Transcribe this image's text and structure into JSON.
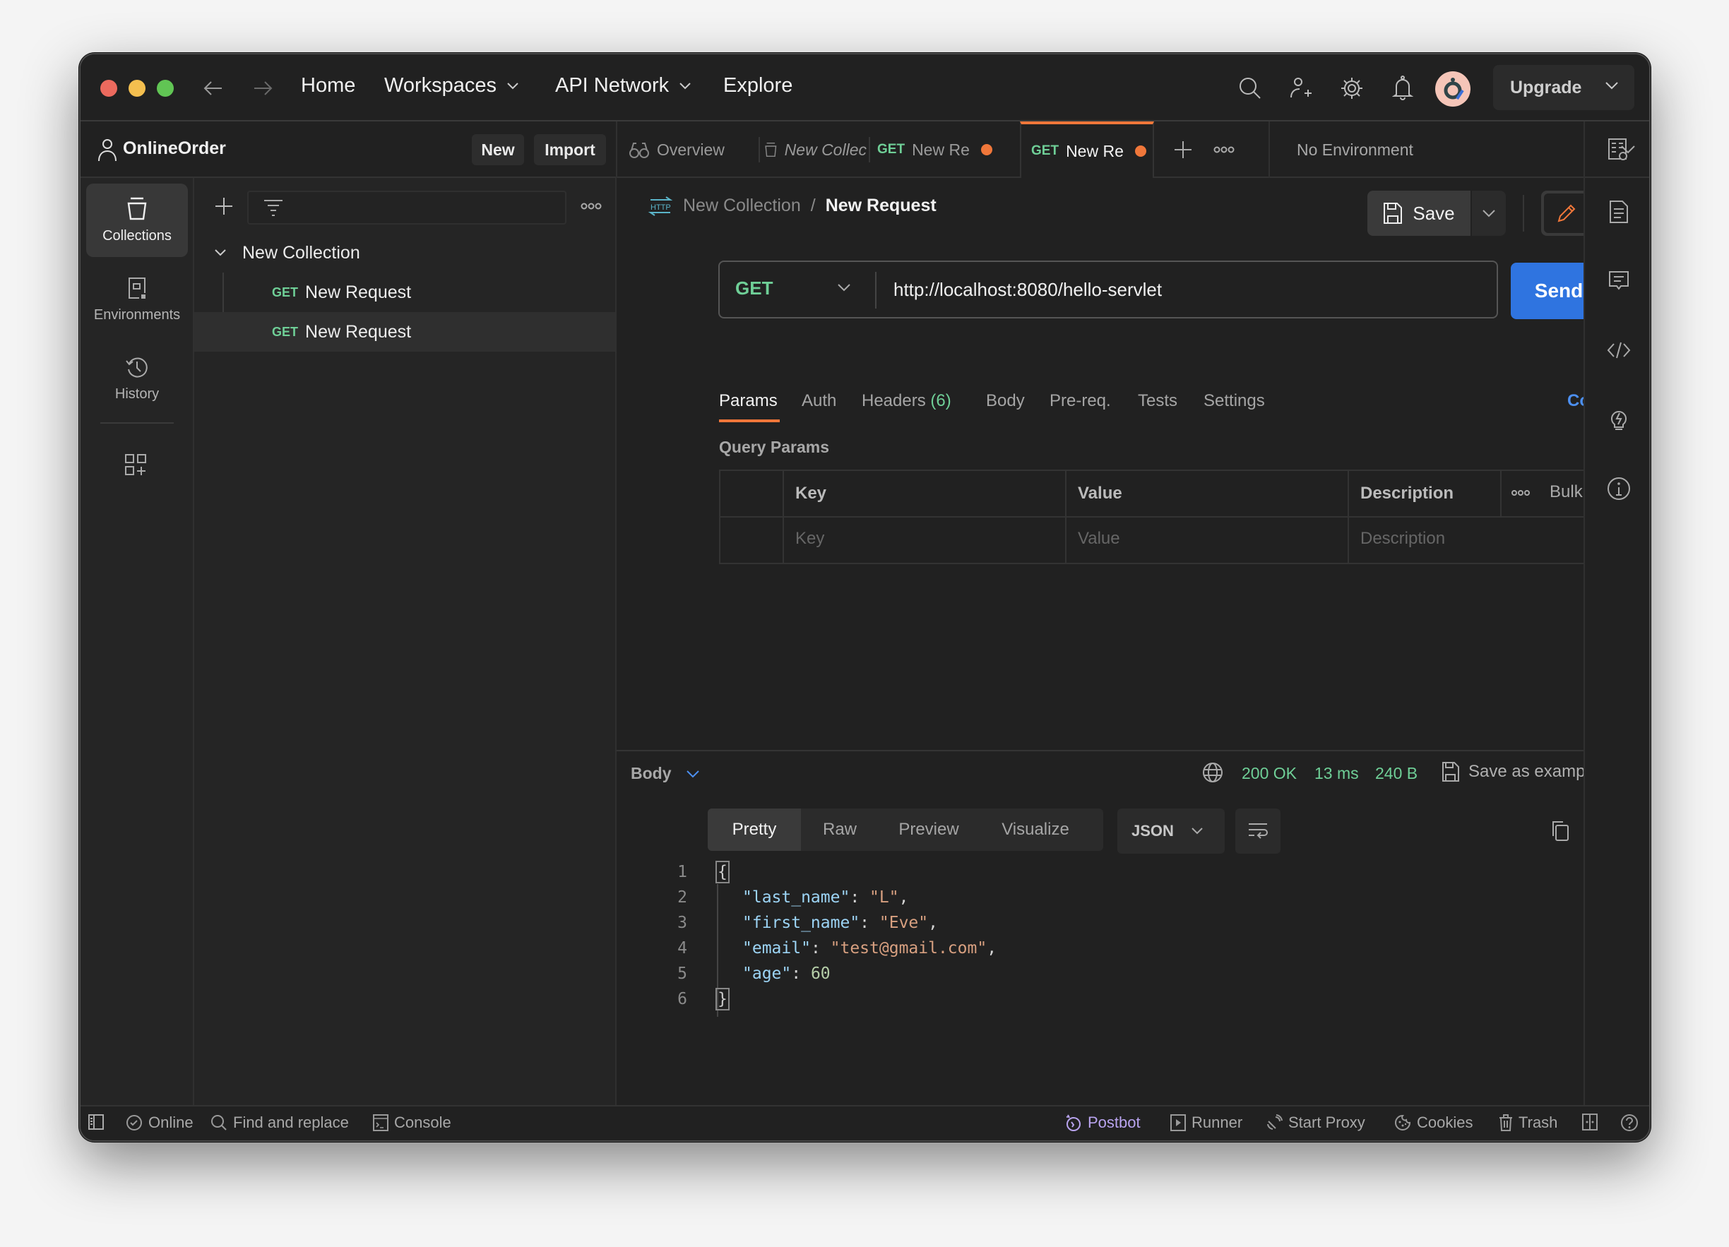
{
  "window": {
    "traffic_lights": {
      "close": "#ec6a5e",
      "minimize": "#f4bf4f",
      "maximize": "#61c554"
    }
  },
  "titlebar": {
    "nav": [
      {
        "label": "Home",
        "has_dropdown": false
      },
      {
        "label": "Workspaces",
        "has_dropdown": true
      },
      {
        "label": "API Network",
        "has_dropdown": true
      },
      {
        "label": "Explore",
        "has_dropdown": false
      }
    ],
    "icons": [
      "search-icon",
      "invite-user-icon",
      "settings-icon",
      "notifications-icon",
      "avatar"
    ],
    "upgrade_label": "Upgrade"
  },
  "workspace": {
    "name": "OnlineOrder",
    "new_label": "New",
    "import_label": "Import"
  },
  "tabs": [
    {
      "label": "Overview",
      "icon": "overview-icon",
      "method": "",
      "unsaved": false,
      "italic": false,
      "active": false
    },
    {
      "label": "New Collec",
      "icon": "collection-icon",
      "method": "",
      "unsaved": false,
      "italic": true,
      "active": false
    },
    {
      "label": "New Re",
      "icon": "",
      "method": "GET",
      "unsaved": true,
      "italic": false,
      "active": false
    },
    {
      "label": "New Re",
      "icon": "",
      "method": "GET",
      "unsaved": true,
      "italic": false,
      "active": true
    }
  ],
  "environment": {
    "selected": "No Environment"
  },
  "leftnav": [
    {
      "label": "Collections",
      "icon": "collections-icon",
      "active": true
    },
    {
      "label": "Environments",
      "icon": "environments-icon",
      "active": false
    },
    {
      "label": "History",
      "icon": "history-icon",
      "active": false
    }
  ],
  "sidebar": {
    "collection": {
      "name": "New Collection",
      "expanded": true,
      "requests": [
        {
          "method": "GET",
          "name": "New Request",
          "selected": false
        },
        {
          "method": "GET",
          "name": "New Request",
          "selected": true
        }
      ]
    }
  },
  "request": {
    "breadcrumb": {
      "parent": "New Collection",
      "separator": "/",
      "current": "New Request"
    },
    "save_label": "Save",
    "method": "GET",
    "url": "http://localhost:8080/hello-servlet",
    "send_label": "Send",
    "tabs": [
      {
        "label": "Params",
        "count": "",
        "active": true
      },
      {
        "label": "Auth",
        "count": "",
        "active": false
      },
      {
        "label": "Headers",
        "count": "(6)",
        "active": false
      },
      {
        "label": "Body",
        "count": "",
        "active": false
      },
      {
        "label": "Pre-req.",
        "count": "",
        "active": false
      },
      {
        "label": "Tests",
        "count": "",
        "active": false
      },
      {
        "label": "Settings",
        "count": "",
        "active": false
      }
    ],
    "cookies_label": "Cookies",
    "query_params": {
      "title": "Query Params",
      "headers": {
        "key": "Key",
        "value": "Value",
        "description": "Description",
        "bulk_edit": "Bulk Edit"
      },
      "placeholders": {
        "key": "Key",
        "value": "Value",
        "description": "Description"
      }
    }
  },
  "response": {
    "section_label": "Body",
    "status": "200 OK",
    "time": "13 ms",
    "size": "240 B",
    "save_example_label": "Save as example",
    "view_modes": [
      "Pretty",
      "Raw",
      "Preview",
      "Visualize"
    ],
    "active_view": "Pretty",
    "format": "JSON",
    "body_lines": [
      {
        "n": "1",
        "type": "open"
      },
      {
        "n": "2",
        "key": "\"last_name\"",
        "value": "\"L\"",
        "value_type": "string",
        "comma": true
      },
      {
        "n": "3",
        "key": "\"first_name\"",
        "value": "\"Eve\"",
        "value_type": "string",
        "comma": true
      },
      {
        "n": "4",
        "key": "\"email\"",
        "value": "\"test@gmail.com\"",
        "value_type": "string",
        "comma": true
      },
      {
        "n": "5",
        "key": "\"age\"",
        "value": "60",
        "value_type": "number",
        "comma": false
      },
      {
        "n": "6",
        "type": "close"
      }
    ]
  },
  "rightrail": [
    "documentation-icon",
    "comments-icon",
    "code-icon",
    "related-icon",
    "info-icon"
  ],
  "statusbar": {
    "left": [
      {
        "label": "",
        "icon": "toggle-sidebar-icon"
      },
      {
        "label": "Online",
        "icon": "online-check-icon"
      },
      {
        "label": "Find and replace",
        "icon": "search-icon"
      },
      {
        "label": "Console",
        "icon": "console-icon"
      }
    ],
    "right": [
      {
        "label": "Postbot",
        "icon": "postbot-icon"
      },
      {
        "label": "Runner",
        "icon": "runner-icon"
      },
      {
        "label": "Start Proxy",
        "icon": "proxy-icon"
      },
      {
        "label": "Cookies",
        "icon": "cookie-icon"
      },
      {
        "label": "Trash",
        "icon": "trash-icon"
      },
      {
        "label": "",
        "icon": "two-pane-icon"
      },
      {
        "label": "",
        "icon": "help-icon"
      }
    ]
  },
  "colors": {
    "accent_orange": "#f0773a",
    "method_get_green": "#6fcf97",
    "send_blue": "#2f74e0",
    "link_blue": "#4c8ff0",
    "postbot_purple": "#b9a4ef"
  }
}
